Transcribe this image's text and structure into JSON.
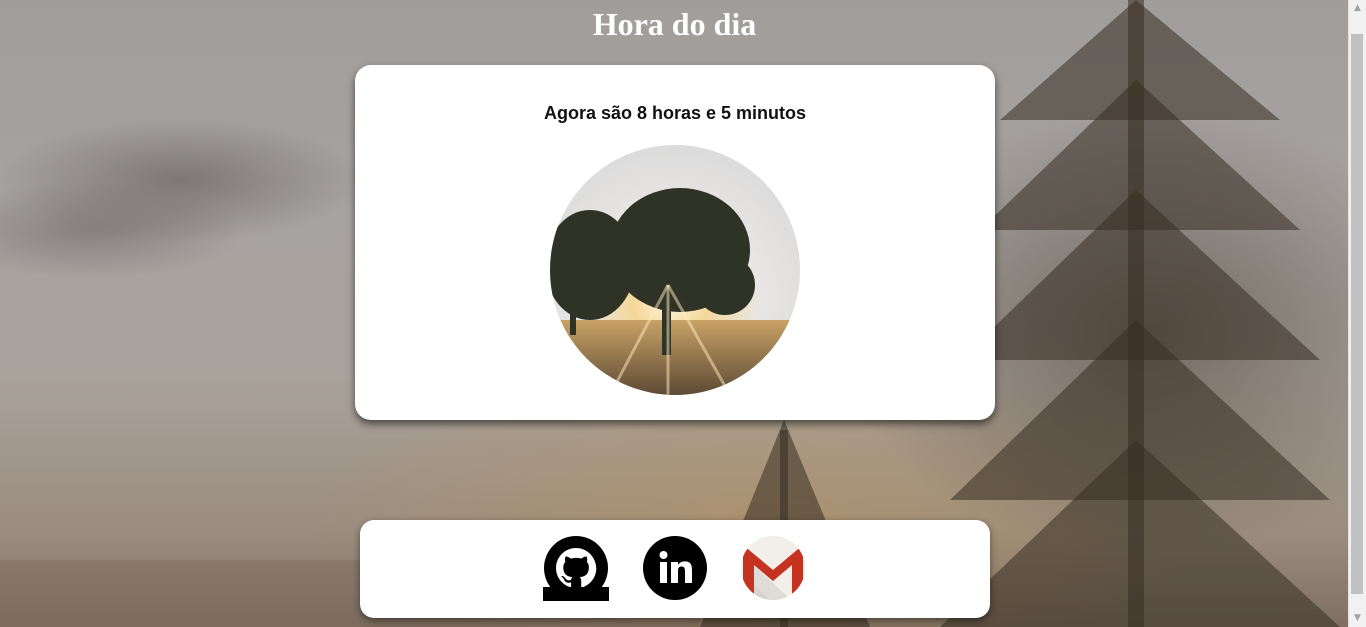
{
  "header": {
    "title": "Hora do dia"
  },
  "main": {
    "time_message": "Agora são 8 horas e 5 minutos",
    "photo_icon": "sunrise-tree-photo"
  },
  "footer": {
    "links": [
      {
        "name": "github-icon"
      },
      {
        "name": "linkedin-icon"
      },
      {
        "name": "gmail-icon"
      }
    ]
  },
  "colors": {
    "card_background": "#ffffff",
    "title_text": "#ffffff",
    "icon_black": "#000000",
    "gmail_red": "#c5321f"
  }
}
